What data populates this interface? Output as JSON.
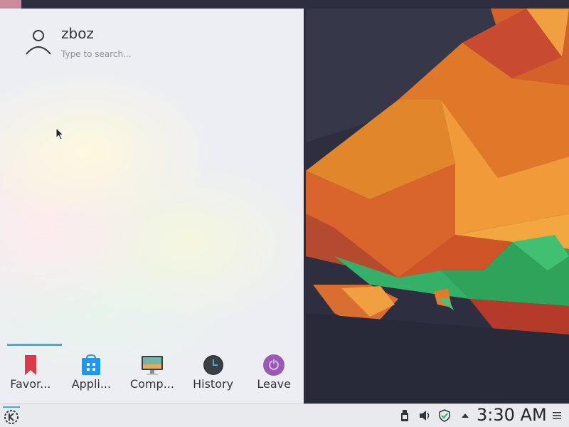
{
  "user": {
    "name": "zboz",
    "search_placeholder": "Type to search..."
  },
  "tabs": [
    {
      "label": "Favor...",
      "icon": "bookmark-icon"
    },
    {
      "label": "Appli...",
      "icon": "applications-icon"
    },
    {
      "label": "Comp...",
      "icon": "computer-icon"
    },
    {
      "label": "History",
      "icon": "clock-icon"
    },
    {
      "label": "Leave",
      "icon": "power-icon"
    }
  ],
  "taskbar": {
    "clock": "3:30 AM",
    "tray_icons": [
      "usb-device-icon",
      "volume-icon",
      "shield-update-icon",
      "expand-tray-icon"
    ]
  },
  "colors": {
    "accent": "#3daee9",
    "favorites": "#da3a4a",
    "applications": "#1d99f3",
    "leave": "#9b59b6"
  }
}
